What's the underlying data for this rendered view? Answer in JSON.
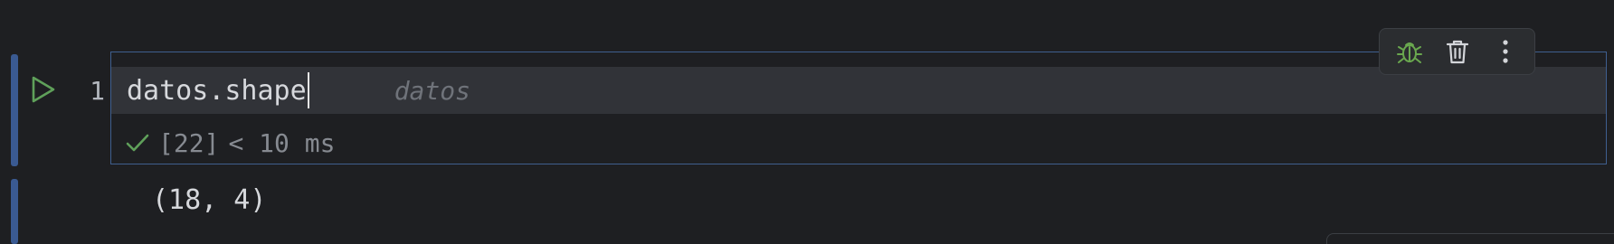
{
  "cell": {
    "line_number": "1",
    "code": "datos.shape",
    "inline_hint": "datos",
    "status": {
      "check_icon": "checkmark-icon",
      "execution_count": "[22]",
      "duration": "< 10 ms"
    },
    "output": "(18, 4)"
  },
  "toolbar": {
    "icons": [
      "bug-icon",
      "trash-icon",
      "more-vertical-icon"
    ]
  },
  "colors": {
    "background": "#1e1f22",
    "cell_marker": "#3a5a92",
    "editor_border": "#3f5f8f",
    "run_green": "#5fa05a",
    "bug_green": "#6aa84f"
  }
}
